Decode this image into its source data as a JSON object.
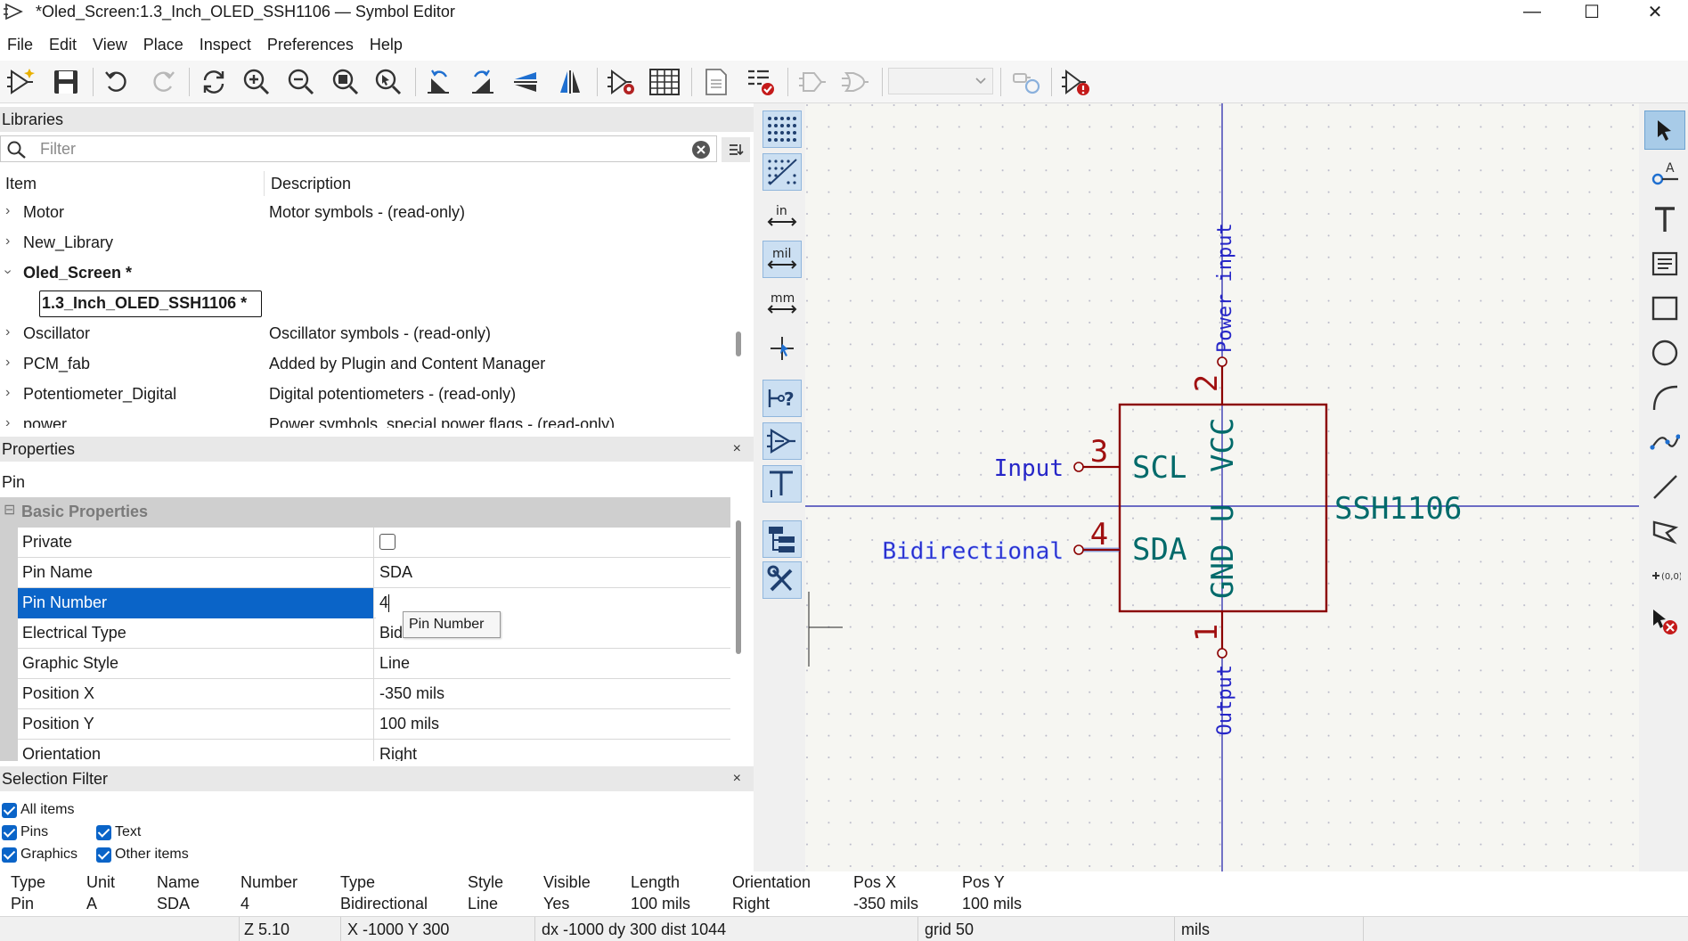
{
  "window": {
    "title": "*Oled_Screen:1.3_Inch_OLED_SSH1106 — Symbol Editor",
    "minimize": "—",
    "maximize": "☐",
    "close": "✕"
  },
  "menu": [
    "File",
    "Edit",
    "View",
    "Place",
    "Inspect",
    "Preferences",
    "Help"
  ],
  "toolbar": {
    "icons": [
      "new-symbol-icon",
      "save-icon",
      "undo-icon",
      "redo-icon",
      "refresh-icon",
      "zoom-in-icon",
      "zoom-out-icon",
      "zoom-fit-icon",
      "zoom-selection-icon",
      "rotate-ccw-icon",
      "rotate-cw-icon",
      "mirror-vertical-icon",
      "mirror-horizontal-icon",
      "symbol-properties-icon",
      "pin-table-icon",
      "datasheet-icon",
      "check-symbol-icon",
      "show-body-style-icon",
      "show-deMorgan-icon",
      "unit-selector",
      "pin-sync-icon",
      "check-symbol-errors-icon"
    ],
    "unit_select_value": ""
  },
  "libraries": {
    "header": "Libraries",
    "filter_placeholder": "Filter",
    "col_item": "Item",
    "col_description": "Description",
    "rows": [
      {
        "name": "Motor",
        "desc": "Motor symbols - (read-only)",
        "expanded": false
      },
      {
        "name": "New_Library",
        "desc": "",
        "expanded": false
      },
      {
        "name": "Oled_Screen *",
        "desc": "",
        "expanded": true
      },
      {
        "name": "1.3_Inch_OLED_SSH1106 *",
        "desc": "",
        "child": true
      },
      {
        "name": "Oscillator",
        "desc": "Oscillator symbols - (read-only)",
        "expanded": false
      },
      {
        "name": "PCM_fab",
        "desc": "Added by Plugin and Content Manager",
        "expanded": false
      },
      {
        "name": "Potentiometer_Digital",
        "desc": "Digital potentiometers - (read-only)",
        "expanded": false
      },
      {
        "name": "power",
        "desc": "Power symbols, special power flags - (read-only)",
        "expanded": false
      }
    ]
  },
  "properties": {
    "header": "Properties",
    "close": "×",
    "subtitle": "Pin",
    "category": "Basic Properties",
    "category_toggle": "⊟",
    "rows": [
      {
        "key": "Private",
        "value": ""
      },
      {
        "key": "Pin Name",
        "value": "SDA"
      },
      {
        "key": "Pin Number",
        "value": "4"
      },
      {
        "key": "Electrical Type",
        "value": "Bidirectional"
      },
      {
        "key": "Graphic Style",
        "value": "Line"
      },
      {
        "key": "Position X",
        "value": "-350 mils"
      },
      {
        "key": "Position Y",
        "value": "100 mils"
      },
      {
        "key": "Orientation",
        "value": "Right"
      }
    ],
    "tooltip": "Pin Number"
  },
  "selection_filter": {
    "header": "Selection Filter",
    "close": "×",
    "items": [
      "All items",
      "Pins",
      "Text",
      "Graphics",
      "Other items"
    ]
  },
  "canvas": {
    "symbol_name": "SSH1106",
    "ref_letter": "U",
    "pins": [
      {
        "number": "3",
        "name": "SCL",
        "type_label": "Input"
      },
      {
        "number": "4",
        "name": "SDA",
        "type_label": "Bidirectional"
      },
      {
        "number": "2",
        "name": "VCC",
        "type_label": "Power input"
      },
      {
        "number": "1",
        "name": "GND",
        "type_label": "Output"
      }
    ],
    "colors": {
      "body": "#8b0000",
      "pin_number": "#a01010",
      "pin_name": "#006a6a",
      "pin_type": "#2626c8",
      "axis": "#1a1aa8",
      "highlight": "#3a6ee0"
    }
  },
  "info": {
    "headers": [
      "Type",
      "Unit",
      "Name",
      "Number",
      "Type",
      "Style",
      "Visible",
      "Length",
      "Orientation",
      "Pos X",
      "Pos Y"
    ],
    "values": [
      "Pin",
      "A",
      "SDA",
      "4",
      "Bidirectional",
      "Line",
      "Yes",
      "100 mils",
      "Right",
      "-350 mils",
      "100 mils"
    ]
  },
  "status": {
    "zoom": "Z 5.10",
    "xy": "X -1000  Y 300",
    "delta": "dx -1000  dy 300  dist 1044",
    "grid": "grid 50",
    "units": "mils"
  }
}
